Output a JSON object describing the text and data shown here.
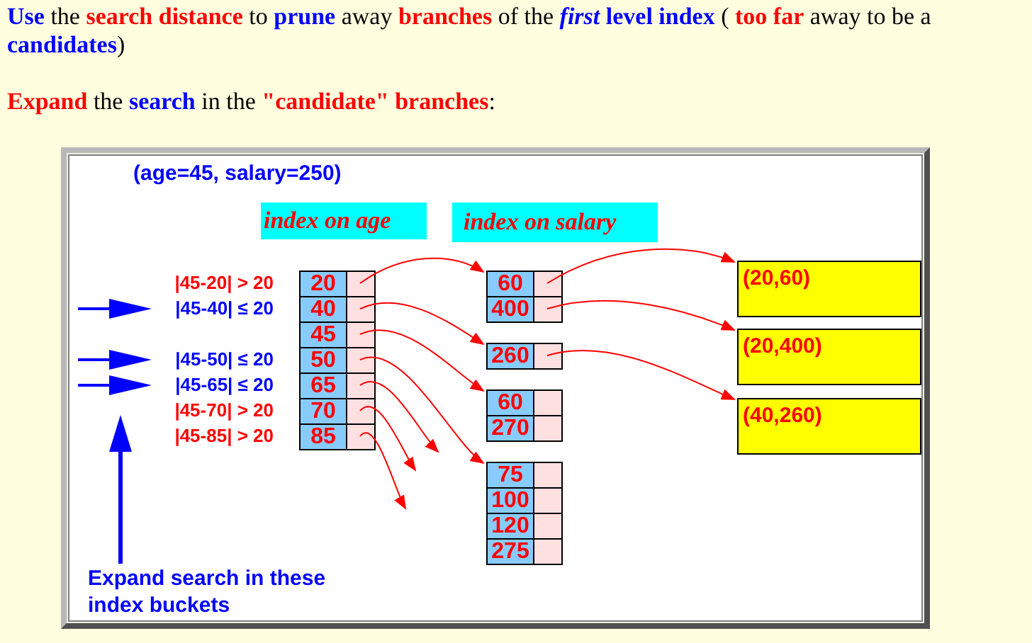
{
  "paragraphs": [
    {
      "runs": [
        {
          "text": "Use",
          "color": "#0000ff",
          "bold": true,
          "italic": false
        },
        {
          "text": " the ",
          "color": "#000000",
          "bold": false,
          "italic": false
        },
        {
          "text": "search distance",
          "color": "#ff0000",
          "bold": true,
          "italic": false
        },
        {
          "text": " to ",
          "color": "#000000",
          "bold": false,
          "italic": false
        },
        {
          "text": "prune",
          "color": "#0000ff",
          "bold": true,
          "italic": false
        },
        {
          "text": " away ",
          "color": "#000000",
          "bold": false,
          "italic": false
        },
        {
          "text": "branches",
          "color": "#ff0000",
          "bold": true,
          "italic": false
        },
        {
          "text": " of the ",
          "color": "#000000",
          "bold": false,
          "italic": false
        },
        {
          "text": "first",
          "color": "#0000ff",
          "bold": true,
          "italic": true
        },
        {
          "text": " level index",
          "color": "#0000ff",
          "bold": true,
          "italic": false
        },
        {
          "text": " ( ",
          "color": "#000000",
          "bold": false,
          "italic": false
        },
        {
          "text": "too far",
          "color": "#ff0000",
          "bold": true,
          "italic": false
        },
        {
          "text": " away to be a ",
          "color": "#000000",
          "bold": false,
          "italic": false
        },
        {
          "text": "candidates",
          "color": "#0000ff",
          "bold": true,
          "italic": false
        },
        {
          "text": ")",
          "color": "#000000",
          "bold": false,
          "italic": false
        }
      ]
    },
    {
      "runs": [
        {
          "text": "Expand",
          "color": "#ff0000",
          "bold": true,
          "italic": false
        },
        {
          "text": " the ",
          "color": "#000000",
          "bold": false,
          "italic": false
        },
        {
          "text": "search",
          "color": "#0000ff",
          "bold": true,
          "italic": false
        },
        {
          "text": " in the ",
          "color": "#000000",
          "bold": false,
          "italic": false
        },
        {
          "text": "\"candidate\" branches",
          "color": "#ff0000",
          "bold": true,
          "italic": false
        },
        {
          "text": ":",
          "color": "#000000",
          "bold": false,
          "italic": false
        }
      ]
    }
  ],
  "diagram": {
    "query": "(age=45, salary=250)",
    "age_label": "index on age",
    "salary_label": "index on salary",
    "age_index": [
      {
        "key": "20",
        "condition": {
          "text": "|45-20| > 20",
          "color": "#ff0000",
          "arrow": false
        }
      },
      {
        "key": "40",
        "condition": {
          "text": "|45-40| ≤ 20",
          "color": "#0000ff",
          "arrow": true
        }
      },
      {
        "key": "45"
      },
      {
        "key": "50",
        "condition": {
          "text": "|45-50| ≤ 20",
          "color": "#0000ff",
          "arrow": true
        }
      },
      {
        "key": "65",
        "condition": {
          "text": "|45-65| ≤ 20",
          "color": "#0000ff",
          "arrow": true
        }
      },
      {
        "key": "70",
        "condition": {
          "text": "|45-70| > 20",
          "color": "#ff0000",
          "arrow": false
        }
      },
      {
        "key": "85",
        "condition": {
          "text": "|45-85| > 20",
          "color": "#ff0000",
          "arrow": false
        }
      }
    ],
    "salary_buckets": [
      [
        {
          "key": "60"
        },
        {
          "key": "400"
        }
      ],
      [
        {
          "key": "260"
        }
      ],
      [
        {
          "key": "60"
        },
        {
          "key": "270"
        }
      ],
      [
        {
          "key": "75"
        },
        {
          "key": "100"
        },
        {
          "key": "120"
        },
        {
          "key": "275"
        }
      ]
    ],
    "results": [
      "(20,60)",
      "(20,400)",
      "(40,260)"
    ],
    "note": "Expand search in these index buckets"
  }
}
